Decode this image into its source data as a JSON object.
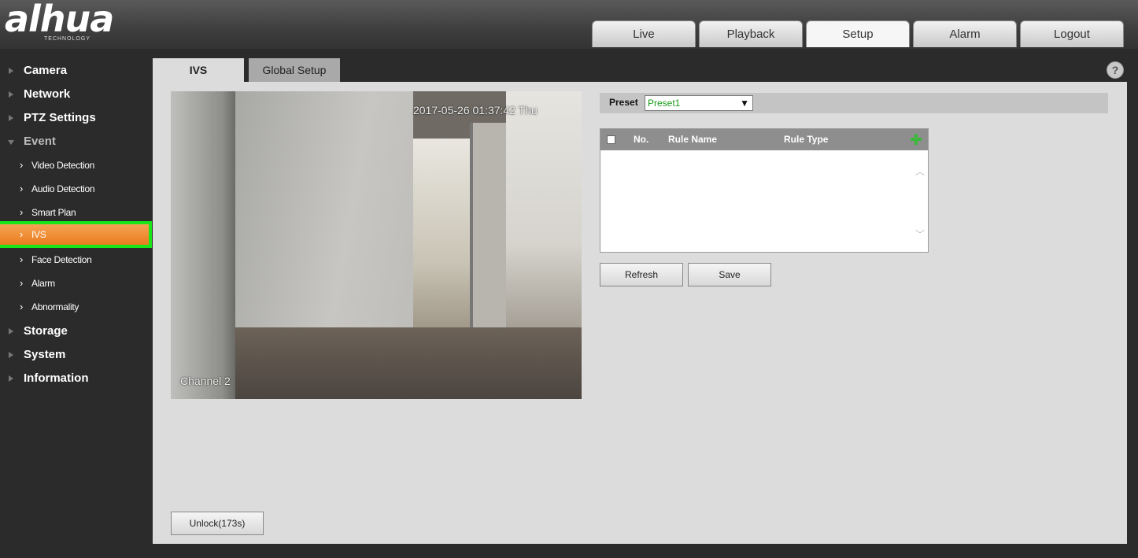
{
  "brand": {
    "name": "alhua",
    "tagline": "TECHNOLOGY"
  },
  "nav": {
    "tabs": [
      {
        "label": "Live"
      },
      {
        "label": "Playback"
      },
      {
        "label": "Setup",
        "active": true
      },
      {
        "label": "Alarm"
      },
      {
        "label": "Logout"
      }
    ]
  },
  "sidebar": {
    "items": [
      {
        "label": "Camera"
      },
      {
        "label": "Network"
      },
      {
        "label": "PTZ Settings"
      },
      {
        "label": "Event",
        "expanded": true
      },
      {
        "label": "Video Detection"
      },
      {
        "label": "Audio Detection"
      },
      {
        "label": "Smart Plan"
      },
      {
        "label": "IVS",
        "active": true
      },
      {
        "label": "Face Detection"
      },
      {
        "label": "Alarm"
      },
      {
        "label": "Abnormality"
      },
      {
        "label": "Storage"
      },
      {
        "label": "System"
      },
      {
        "label": "Information"
      }
    ]
  },
  "subtabs": {
    "ivs": "IVS",
    "global": "Global Setup"
  },
  "help": {
    "glyph": "?"
  },
  "video": {
    "timestamp": "2017-05-26 01:37:42 Thu",
    "channel": "Channel 2"
  },
  "preset": {
    "label": "Preset",
    "value": "Preset1",
    "value_color": "#1a9a1a"
  },
  "rules": {
    "headers": {
      "no": "No.",
      "name": "Rule Name",
      "type": "Rule Type"
    },
    "rows": []
  },
  "buttons": {
    "refresh": "Refresh",
    "save": "Save",
    "unlock": "Unlock(173s)"
  },
  "colors": {
    "active_item": "#e97d1e",
    "highlight_outline": "#19e619",
    "add_icon": "#3cb83c"
  },
  "icons": {
    "add": "plus-icon",
    "help": "help-icon",
    "dropdown": "chevron-down-icon"
  }
}
